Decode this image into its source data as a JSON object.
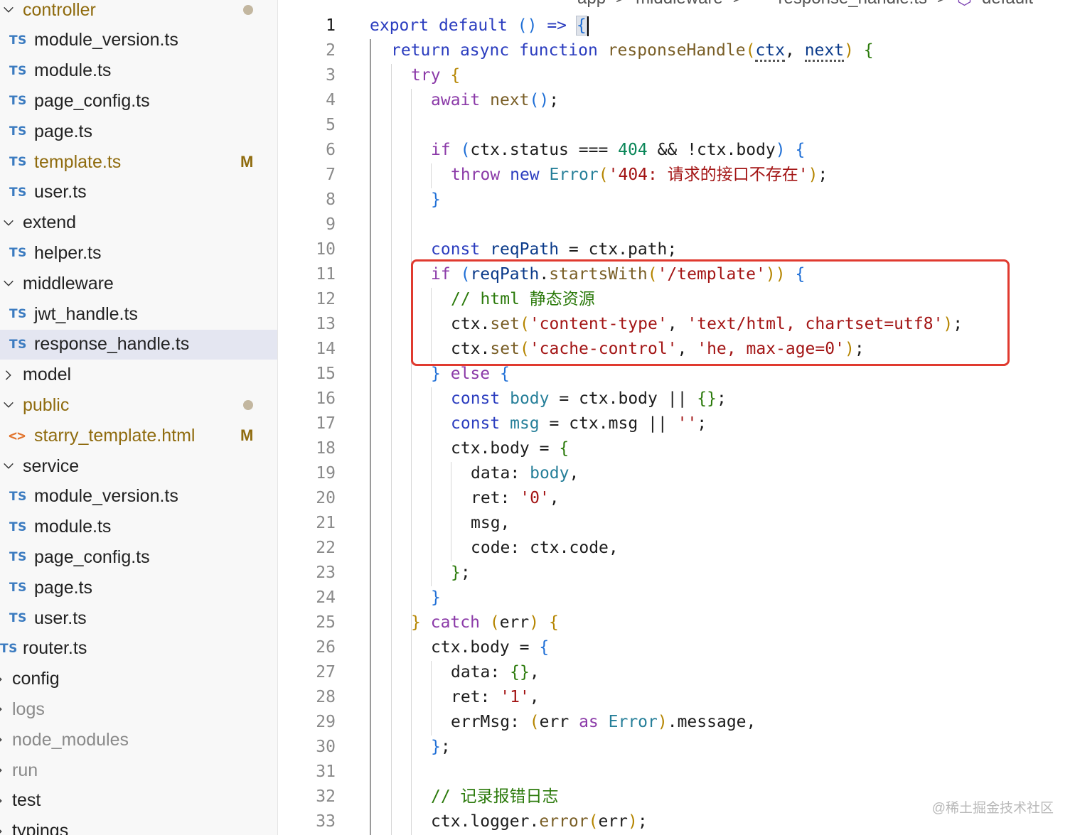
{
  "breadcrumb": [
    "app",
    ">",
    "middleware",
    ">",
    "TS",
    "response_handle.ts",
    ">",
    "default"
  ],
  "tree": [
    {
      "label": "controller",
      "type": "folder",
      "expanded": true,
      "status": "dot"
    },
    {
      "label": "module_version.ts",
      "type": "ts"
    },
    {
      "label": "module.ts",
      "type": "ts"
    },
    {
      "label": "page_config.ts",
      "type": "ts"
    },
    {
      "label": "page.ts",
      "type": "ts"
    },
    {
      "label": "template.ts",
      "type": "ts",
      "status": "M"
    },
    {
      "label": "user.ts",
      "type": "ts"
    },
    {
      "label": "extend",
      "type": "folder",
      "expanded": true
    },
    {
      "label": "helper.ts",
      "type": "ts"
    },
    {
      "label": "middleware",
      "type": "folder",
      "expanded": true
    },
    {
      "label": "jwt_handle.ts",
      "type": "ts"
    },
    {
      "label": "response_handle.ts",
      "type": "ts",
      "selected": true
    },
    {
      "label": "model",
      "type": "folder",
      "expanded": false
    },
    {
      "label": "public",
      "type": "folder",
      "expanded": true,
      "status": "dot"
    },
    {
      "label": "starry_template.html",
      "type": "html",
      "status": "M"
    },
    {
      "label": "service",
      "type": "folder",
      "expanded": true
    },
    {
      "label": "module_version.ts",
      "type": "ts"
    },
    {
      "label": "module.ts",
      "type": "ts"
    },
    {
      "label": "page_config.ts",
      "type": "ts"
    },
    {
      "label": "page.ts",
      "type": "ts"
    },
    {
      "label": "user.ts",
      "type": "ts"
    },
    {
      "label": "router.ts",
      "type": "ts-root"
    },
    {
      "label": "config",
      "type": "root"
    },
    {
      "label": "logs",
      "type": "root-dim"
    },
    {
      "label": "node_modules",
      "type": "root-dim"
    },
    {
      "label": "run",
      "type": "root-dim"
    },
    {
      "label": "test",
      "type": "root"
    },
    {
      "label": "typings",
      "type": "root"
    }
  ],
  "icons": {
    "ts": "TS",
    "html": "<>"
  },
  "badges": {
    "modified": "M"
  },
  "code": {
    "l1a": "export",
    "l1b": "default",
    "l1c": "()",
    "l1d": "=>",
    "l1e": "{",
    "l2a": "return",
    "l2b": "async",
    "l2c": "function",
    "l2d": "responseHandle",
    "l2e": "(",
    "l2f": "ctx",
    ", ": ", ",
    "l2g": "next",
    "l2h": ")",
    "l2i": "{",
    "l3a": "try",
    "l3b": "{",
    "l4a": "await",
    "l4b": "next",
    "l4c": "()",
    ";": ";",
    "l6a": "if",
    "l6b": "(",
    "l6c": "ctx",
    "l6d": ".status",
    "l6e": "===",
    "l6f": "404",
    "l6g": "&&",
    "l6h": "!ctx",
    ".body": ".body",
    "l6i": ")",
    "l6j": "{",
    "l7a": "throw",
    "l7b": "new",
    "l7c": "Error",
    "l7d": "(",
    "l7e": "'404: 请求的接口不存在'",
    "l7f": ")",
    "l8a": "}",
    "l10a": "const",
    "l10b": "reqPath",
    "l10c": "=",
    "l10d": "ctx",
    "l10e": ".path",
    "l11a": "if",
    "l11b": "(",
    "l11c": "reqPath",
    ".startsWith": ".",
    "l11d": "startsWith",
    "l11e": "(",
    "l11f": "'/template'",
    "l11g": "))",
    "l11h": "{",
    "l12a": "// html 静态资源",
    "l13a": "ctx",
    "l13b": ".",
    "l13c": "set",
    "l13d": "(",
    "l13e": "'content-type'",
    "l13f": ", ",
    "l13g": "'text/html, chartset=utf8'",
    "l13h": ")",
    "l14a": "ctx",
    "l14b": "set",
    "l14c": "'cache-control'",
    "l14d": "'he, max-age=0'",
    "l15a": "}",
    "l15b": "else",
    "l15c": "{",
    "l16a": "const",
    "l16b": "body",
    "l16c": "=",
    "l16d": "ctx.body",
    "l16e": "||",
    "l16f": "{}",
    "l17a": "const",
    "l17b": "msg",
    "l17c": "=",
    "l17d": "ctx.msg",
    "l17e": "||",
    "l17f": "''",
    "l18a": "ctx.body",
    "l18b": "=",
    "l18c": "{",
    "l19a": "data:",
    "l19b": "body",
    "l20a": "ret:",
    "l20b": "'0'",
    "l21a": "msg",
    "l22a": "code:",
    "l22b": "ctx",
    "l22c": ".code",
    "l23a": "}",
    "l24a": "}",
    "l25a": "}",
    "l25b": "catch",
    "l25c": "(",
    "l25d": "err",
    "l25e": ")",
    "l25f": "{",
    "l26a": "ctx.body",
    "l26b": "=",
    "l26c": "{",
    "l27a": "data:",
    "l27b": "{}",
    "l28a": "ret:",
    "l28b": "'1'",
    "l29a": "errMsg:",
    "l29b": "(",
    "l29c": "err",
    "l29d": "as",
    "l29e": "Error",
    "l29f": ")",
    "l29g": ".message",
    "l30a": "}",
    "l32a": "// 记录报错日志",
    "l33a": "ctx",
    "l33b": ".logger",
    "l33c": ".",
    "l33d": "error",
    "l33e": "(",
    "l33f": "err",
    "l33g": ")"
  },
  "line_numbers": [
    "1",
    "2",
    "3",
    "4",
    "5",
    "6",
    "7",
    "8",
    "9",
    "10",
    "11",
    "12",
    "13",
    "14",
    "15",
    "16",
    "17",
    "18",
    "19",
    "20",
    "21",
    "22",
    "23",
    "24",
    "25",
    "26",
    "27",
    "28",
    "29",
    "30",
    "31",
    "32",
    "33"
  ],
  "watermark": "@稀土掘金技术社区",
  "colors": {
    "highlight_box": "#e03a2f",
    "selected_row": "#e4e6f1",
    "modified": "#8f6b0e",
    "ts_icon": "#3b7bc0"
  }
}
